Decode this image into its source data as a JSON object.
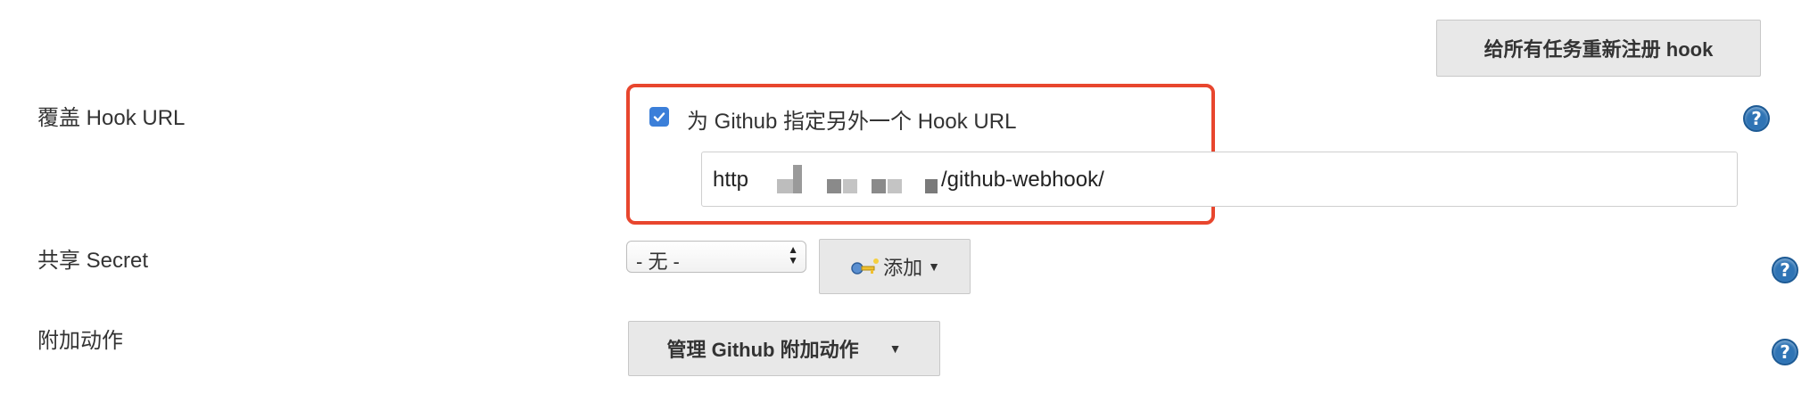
{
  "toolbar": {
    "reregister_label": "给所有任务重新注册 hook"
  },
  "override_hook": {
    "label": "覆盖 Hook URL",
    "checkbox_label": "为 Github 指定另外一个 Hook URL",
    "checked": true,
    "url_value_visible_prefix": "http",
    "url_value_visible_suffix": "/github-webhook/"
  },
  "shared_secret": {
    "label": "共享 Secret",
    "select_value": "- 无 -",
    "add_label": "添加"
  },
  "additional_actions": {
    "label": "附加动作",
    "manage_label": "管理 Github 附加动作"
  },
  "help_icon": "?",
  "colors": {
    "highlight_border": "#e8462e",
    "checkbox": "#3b7fd9",
    "help_icon": "#2f74b5",
    "button_bg": "#e8e8e8"
  }
}
